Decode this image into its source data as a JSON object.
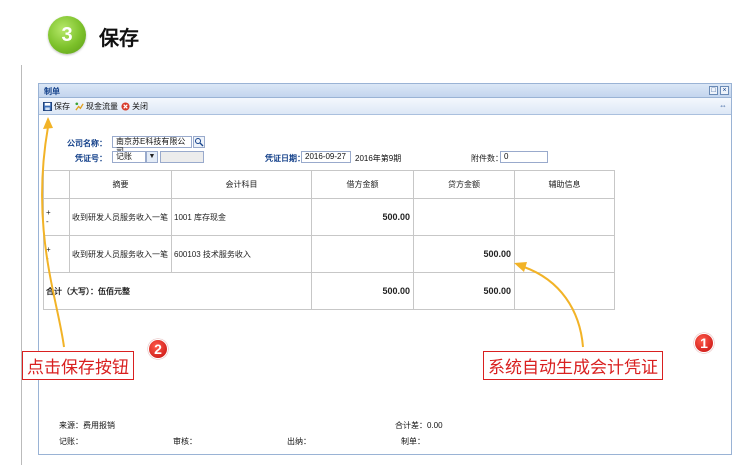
{
  "step": {
    "number": "3",
    "title": "保存"
  },
  "window": {
    "title": "制单",
    "btn_restore": "□",
    "btn_close": "×"
  },
  "toolbar": {
    "save": "保存",
    "cashflow": "现金流量",
    "close": "关闭",
    "right_icon": "⇔"
  },
  "form": {
    "company_label": "公司名称：",
    "company_value": "南京苏E科技有限公司",
    "voucher_label": "凭证号：",
    "voucher_value": "记账",
    "date_label": "凭证日期：",
    "date_value": "2016-09-27",
    "period_text": "2016年第9期",
    "attach_label": "附件数：",
    "attach_value": "0"
  },
  "table": {
    "headers": [
      "摘要",
      "会计科目",
      "借方金额",
      "贷方金额",
      "辅助信息"
    ],
    "rows": [
      {
        "pm": "+\n-",
        "summary": "收到研发人员服务收入一笔",
        "account": "1001 库存现金",
        "debit": "500.00",
        "credit": "",
        "aux": ""
      },
      {
        "pm": "+\n-",
        "summary": "收到研发人员服务收入一笔",
        "account": "600103 技术服务收入",
        "debit": "",
        "credit": "500.00",
        "aux": ""
      }
    ],
    "total": {
      "label": "合计（大写）：伍佰元整",
      "debit": "500.00",
      "credit": "500.00"
    }
  },
  "footer": {
    "source": "来源：费用报销",
    "diff": "合计差：0.00",
    "bookkeeper": "记账：",
    "reviewer": "审核：",
    "cashier": "出纳：",
    "maker": "制单："
  },
  "annotations": [
    {
      "text": "点击保存按钮",
      "badge": "2"
    },
    {
      "text": "系统自动生成会计凭证",
      "badge": "1"
    }
  ],
  "colors": {
    "step_green": "#7cc12a",
    "annot_red": "#d92020",
    "arrow_yellow": "#f2b327",
    "label_blue": "#15428b"
  }
}
